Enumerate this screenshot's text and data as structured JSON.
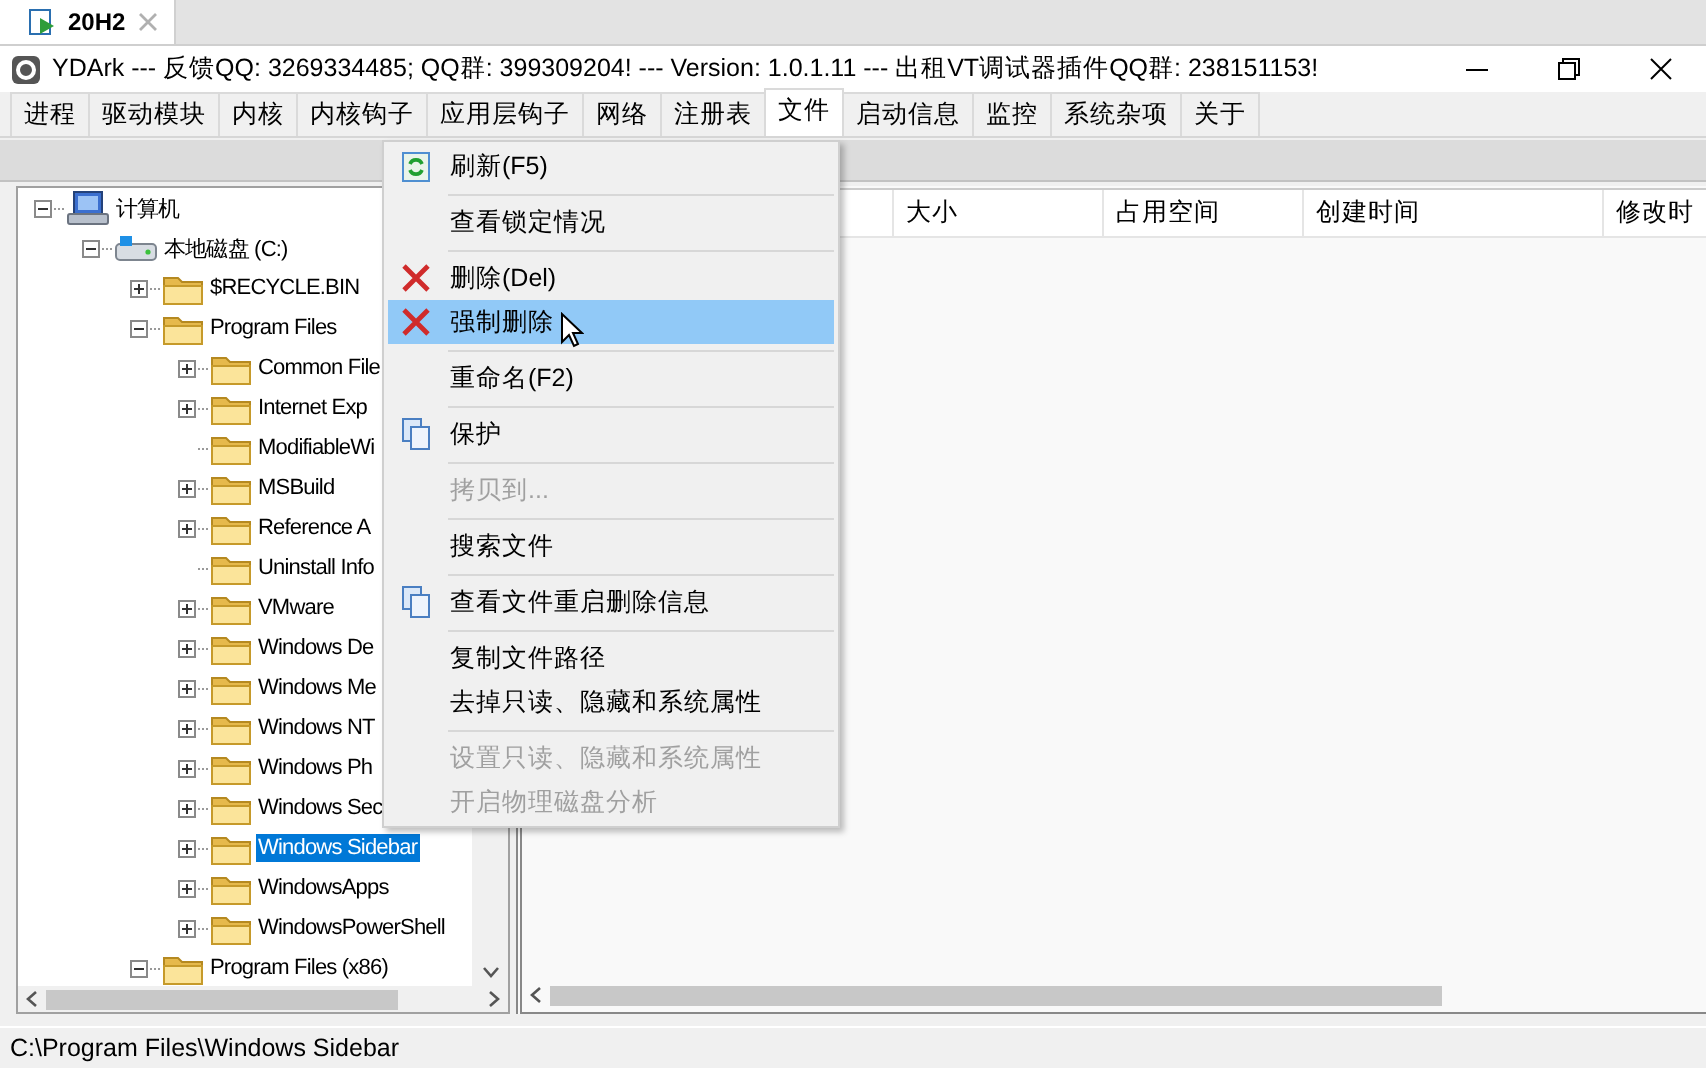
{
  "doc_tab": {
    "label": "20H2"
  },
  "window": {
    "title": "YDArk --- 反馈QQ: 3269334485; QQ群: 399309204! --- Version: 1.0.1.11  --- 出租VT调试器插件QQ群: 238151153!"
  },
  "tabs": [
    {
      "label": "进程",
      "selected": false
    },
    {
      "label": "驱动模块",
      "selected": false
    },
    {
      "label": "内核",
      "selected": false
    },
    {
      "label": "内核钩子",
      "selected": false
    },
    {
      "label": "应用层钩子",
      "selected": false
    },
    {
      "label": "网络",
      "selected": false
    },
    {
      "label": "注册表",
      "selected": false
    },
    {
      "label": "文件",
      "selected": true
    },
    {
      "label": "启动信息",
      "selected": false
    },
    {
      "label": "监控",
      "selected": false
    },
    {
      "label": "系统杂项",
      "selected": false
    },
    {
      "label": "关于",
      "selected": false
    }
  ],
  "tree": [
    {
      "label": "计算机",
      "kind": "computer",
      "expanded": true,
      "selected": false,
      "children": [
        {
          "label": "本地磁盘 (C:)",
          "kind": "drive",
          "expanded": true,
          "selected": false,
          "children": [
            {
              "label": "$RECYCLE.BIN",
              "kind": "folder",
              "expanded": false,
              "selected": false
            },
            {
              "label": "Program Files",
              "kind": "folder",
              "expanded": true,
              "selected": false,
              "children": [
                {
                  "label": "Common File",
                  "kind": "folder",
                  "expanded": false,
                  "selected": false
                },
                {
                  "label": "Internet Exp",
                  "kind": "folder",
                  "expanded": false,
                  "selected": false
                },
                {
                  "label": "ModifiableWi",
                  "kind": "folder",
                  "selected": false
                },
                {
                  "label": "MSBuild",
                  "kind": "folder",
                  "expanded": false,
                  "selected": false
                },
                {
                  "label": "Reference A",
                  "kind": "folder",
                  "expanded": false,
                  "selected": false
                },
                {
                  "label": "Uninstall Info",
                  "kind": "folder",
                  "selected": false
                },
                {
                  "label": "VMware",
                  "kind": "folder",
                  "expanded": false,
                  "selected": false
                },
                {
                  "label": "Windows De",
                  "kind": "folder",
                  "expanded": false,
                  "selected": false
                },
                {
                  "label": "Windows Me",
                  "kind": "folder",
                  "expanded": false,
                  "selected": false
                },
                {
                  "label": "Windows NT",
                  "kind": "folder",
                  "expanded": false,
                  "selected": false
                },
                {
                  "label": "Windows Ph",
                  "kind": "folder",
                  "expanded": false,
                  "selected": false
                },
                {
                  "label": "Windows Sec",
                  "kind": "folder",
                  "expanded": false,
                  "selected": false
                },
                {
                  "label": "Windows Sidebar",
                  "kind": "folder",
                  "expanded": false,
                  "selected": true
                },
                {
                  "label": "WindowsApps",
                  "kind": "folder",
                  "expanded": false,
                  "selected": false
                },
                {
                  "label": "WindowsPowerShell",
                  "kind": "folder",
                  "expanded": false,
                  "selected": false
                }
              ]
            },
            {
              "label": "Program Files (x86)",
              "kind": "folder",
              "expanded": true,
              "selected": false
            }
          ]
        }
      ]
    }
  ],
  "table": {
    "columns": [
      "大小",
      "占用空间",
      "创建时间",
      "修改时"
    ]
  },
  "context_menu": [
    {
      "kind": "refresh",
      "label": "刷新(F5)",
      "selected": false,
      "disabled": false
    },
    {
      "kind": "separator"
    },
    {
      "kind": "item",
      "label": "查看锁定情况",
      "selected": false,
      "disabled": false
    },
    {
      "kind": "separator"
    },
    {
      "kind": "delete",
      "label": "删除(Del)",
      "selected": false,
      "disabled": false
    },
    {
      "kind": "delete",
      "label": "强制删除",
      "selected": true,
      "disabled": false
    },
    {
      "kind": "separator"
    },
    {
      "kind": "item",
      "label": "重命名(F2)",
      "selected": false,
      "disabled": false
    },
    {
      "kind": "separator"
    },
    {
      "kind": "copy",
      "label": "保护",
      "selected": false,
      "disabled": false
    },
    {
      "kind": "separator"
    },
    {
      "kind": "item",
      "label": "拷贝到...",
      "selected": false,
      "disabled": true
    },
    {
      "kind": "separator"
    },
    {
      "kind": "item",
      "label": "搜索文件",
      "selected": false,
      "disabled": false
    },
    {
      "kind": "separator"
    },
    {
      "kind": "copy",
      "label": "查看文件重启删除信息",
      "selected": false,
      "disabled": false
    },
    {
      "kind": "separator"
    },
    {
      "kind": "item",
      "label": "复制文件路径",
      "selected": false,
      "disabled": false
    },
    {
      "kind": "item",
      "label": "去掉只读、隐藏和系统属性",
      "selected": false,
      "disabled": false
    },
    {
      "kind": "separator"
    },
    {
      "kind": "item",
      "label": "设置只读、隐藏和系统属性",
      "selected": false,
      "disabled": true
    },
    {
      "kind": "item",
      "label": "开启物理磁盘分析",
      "selected": false,
      "disabled": true
    }
  ],
  "status_bar": {
    "path": "C:\\Program Files\\Windows Sidebar"
  }
}
